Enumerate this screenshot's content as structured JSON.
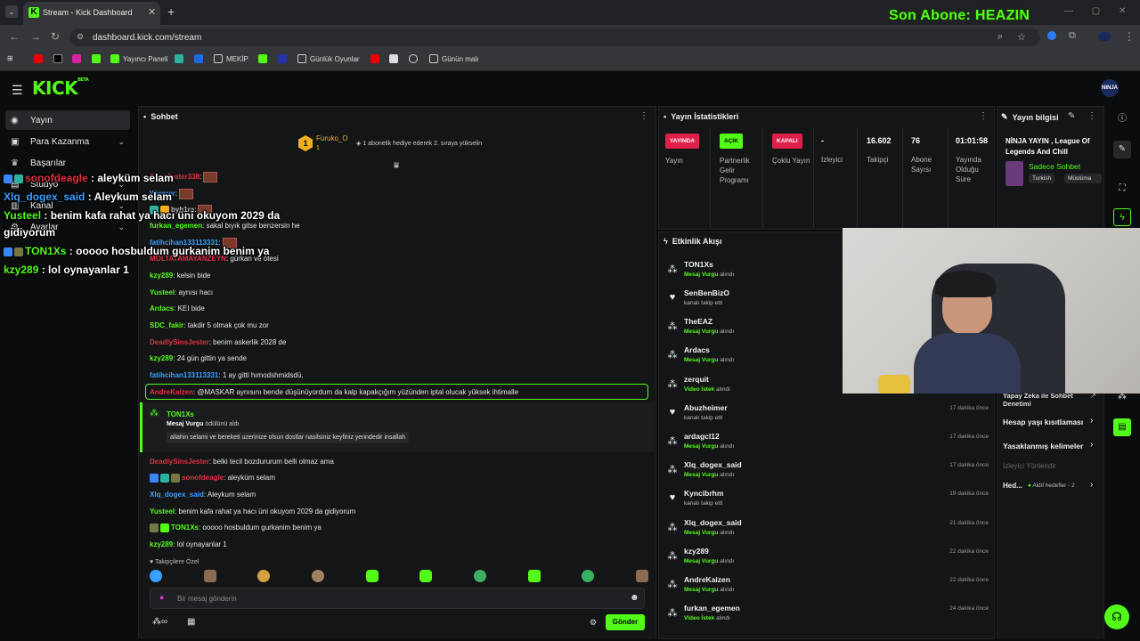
{
  "browser": {
    "tab_title": "Stream - Kick Dashboard",
    "url": "dashboard.kick.com/stream",
    "bookmarks": [
      "Yayıncı Paneli",
      "MEKİP",
      "Günlük Oyunlar",
      "Günün malı"
    ]
  },
  "overlay": {
    "last_sub": "Son Abone: HEAZIN",
    "chat": [
      {
        "user": "sonofdeagle",
        "text": " : aleyküm selam",
        "color": "#e03040"
      },
      {
        "user": "Xlq_dogex_said",
        "text": " : Aleykum selam",
        "color": "#3aa0ff"
      },
      {
        "user": "Yusteel",
        "text": " : benim kafa rahat ya hacı üni okuyom 2029 da",
        "color": "#53fc18"
      },
      {
        "user": "",
        "text": "gidiyorum",
        "color": "#fff"
      },
      {
        "user": "TON1Xs",
        "text": " : ooooo hosbuldum gurkanim benim ya",
        "color": "#53fc18"
      },
      {
        "user": "kzy289",
        "text": " : lol oynayanlar 1",
        "color": "#53fc18"
      }
    ]
  },
  "sidebar": {
    "items": [
      {
        "label": "Yayın",
        "icon": "stream-icon"
      },
      {
        "label": "Para Kazanma",
        "icon": "money-icon"
      },
      {
        "label": "Başarılar",
        "icon": "trophy-icon"
      },
      {
        "label": "Stüdyo",
        "icon": "studio-icon"
      },
      {
        "label": "Kanal",
        "icon": "channel-icon"
      },
      {
        "label": "Ayarlar",
        "icon": "settings-icon"
      }
    ]
  },
  "chat": {
    "title": "Sohbet",
    "pinned_user": "Furuko_O",
    "pinned_rank": "1",
    "pinned_count": "1",
    "pinned_text": "1 abonelik hediye ederek 2. sıraya yükselin",
    "messages": [
      {
        "user": "SlinsJester338",
        "text": ":",
        "color": "#e03040"
      },
      {
        "user": "Wwerer",
        "text": ":",
        "color": "#3aa0ff"
      },
      {
        "user": "byh1ra",
        "text": ":",
        "color": "#bbb"
      },
      {
        "user": "furkan_egemen",
        "text": ": sakal bıyık gitse benzersin he",
        "color": "#53fc18"
      },
      {
        "user": "fatihcihan133113331",
        "text": ":",
        "color": "#3aa0ff"
      },
      {
        "user": "MOLTATAMAYANZEYN",
        "text": ": gürkan ve ötesi",
        "color": "#e03040"
      },
      {
        "user": "kzy289",
        "text": ": kelsin bide",
        "color": "#53fc18"
      },
      {
        "user": "Yusteel",
        "text": ": aynısı hacı",
        "color": "#53fc18"
      },
      {
        "user": "Ardacs",
        "text": ": KEI bide",
        "color": "#53fc18"
      },
      {
        "user": "SDC_fakir",
        "text": ": takdir 5 olmak çok mu zor",
        "color": "#53fc18"
      },
      {
        "user": "DeadlySinsJester",
        "text": ": benim askerlik 2028 de",
        "color": "#e03040"
      },
      {
        "user": "kzy289",
        "text": ": 24 gün gittin ya sende",
        "color": "#53fc18"
      },
      {
        "user": "fatihcihan133113331",
        "text": ": 1 ay gitti hımodshmidsdü,",
        "color": "#3aa0ff"
      },
      {
        "user": "AndreKaizen",
        "text": ": @MASKAR aynısını bende düşünüyordum da kalp kapakçığım yüzünden iptal olucak yüksek ihtimalle",
        "color": "#e03040"
      },
      {
        "user": "DeadlySinsJester",
        "text": ": belki tecil bozdururum belli olmaz ama",
        "color": "#e03040"
      },
      {
        "user": "sonofdeagle",
        "text": ": aleyküm selam",
        "color": "#e03040"
      },
      {
        "user": "Xlq_dogex_said",
        "text": ": Aleykum selam",
        "color": "#3aa0ff"
      },
      {
        "user": "Yusteel",
        "text": ": benim kafa rahat ya hacı üni okuyom 2029 da gidiyorum",
        "color": "#53fc18"
      },
      {
        "user": "TON1Xs",
        "text": ": ooooo hosbuldum gurkanim benim ya",
        "color": "#53fc18"
      },
      {
        "user": "kzy289",
        "text": ": lol oynayanlar 1",
        "color": "#53fc18"
      }
    ],
    "highlight": {
      "user": "TON1Xs",
      "action": "Mesaj Vurgu",
      "action_suffix": " ödülünü aldı",
      "text": "allahin selami ve bereketi uzerinize olsun dostlar nasilsiniz keyfiniz yerindedir insallah"
    },
    "emote_tab": "Takipçilere Özel",
    "input_placeholder": "Bir mesaj gönderin",
    "send_label": "Gönder"
  },
  "stats": {
    "title": "Yayın İstatistikleri",
    "cols": [
      {
        "pill": "YAYINDA",
        "pill_color": "#e0204a",
        "label": "Yayın"
      },
      {
        "pill": "AÇIK",
        "pill_color": "#53fc18",
        "label": "Partnerlik Gelir Programı"
      },
      {
        "pill": "KAPALI",
        "pill_color": "#e0204a",
        "label": "Çoklu Yayın"
      },
      {
        "value": "-",
        "label": "İzleyici"
      },
      {
        "value": "16.602",
        "label": "Takipçi"
      },
      {
        "value": "76",
        "label": "Abone Sayısı"
      },
      {
        "value": "01:01:58",
        "label": "Yayında Olduğu Süre"
      }
    ]
  },
  "activity": {
    "title": "Etkinlik Akışı",
    "items": [
      {
        "name": "TON1Xs",
        "desc_hl": "Mesaj Vurgu",
        "desc": " alındı",
        "time": "",
        "icon": "highlight-icon"
      },
      {
        "name": "SenBenBizO",
        "desc_hl": "",
        "desc": "kanalı takip etti",
        "time": "",
        "icon": "heart-icon"
      },
      {
        "name": "TheEAZ",
        "desc_hl": "Mesaj Vurgu",
        "desc": " alındı",
        "time": "",
        "icon": "highlight-icon"
      },
      {
        "name": "Ardacs",
        "desc_hl": "Mesaj Vurgu",
        "desc": " alındı",
        "time": "",
        "icon": "highlight-icon"
      },
      {
        "name": "zerquit",
        "desc_hl": "Video İstek",
        "desc": " alındı",
        "time": "",
        "icon": "highlight-icon"
      },
      {
        "name": "Abuzheimer",
        "desc_hl": "",
        "desc": "kanalı takip etti",
        "time": "17 dakika önce",
        "icon": "heart-icon"
      },
      {
        "name": "ardagcl12",
        "desc_hl": "Mesaj Vurgu",
        "desc": " alındı",
        "time": "17 dakika önce",
        "icon": "highlight-icon"
      },
      {
        "name": "Xlq_dogex_said",
        "desc_hl": "Mesaj Vurgu",
        "desc": " alındı",
        "time": "17 dakika önce",
        "icon": "highlight-icon"
      },
      {
        "name": "Kyncibrhm",
        "desc_hl": "",
        "desc": "kanalı takip etti",
        "time": "19 dakika önce",
        "icon": "heart-icon"
      },
      {
        "name": "Xlq_dogex_said",
        "desc_hl": "Mesaj Vurgu",
        "desc": " alındı",
        "time": "21 dakika önce",
        "icon": "highlight-icon"
      },
      {
        "name": "kzy289",
        "desc_hl": "Mesaj Vurgu",
        "desc": " alındı",
        "time": "22 dakika önce",
        "icon": "highlight-icon"
      },
      {
        "name": "AndreKaizen",
        "desc_hl": "Mesaj Vurgu",
        "desc": " alındı",
        "time": "22 dakika önce",
        "icon": "highlight-icon"
      },
      {
        "name": "furkan_egemen",
        "desc_hl": "Video İstek",
        "desc": " alındı",
        "time": "24 dakika önce",
        "icon": "highlight-icon"
      }
    ]
  },
  "info": {
    "title": "Yayın bilgisi",
    "stream_title": "NİNJA YAYIN , League Of Legends And Chill",
    "category": "Sadece Sohbet",
    "tags": [
      "Turkish",
      "Müslüma"
    ],
    "links": [
      {
        "label": "Yapay Zeka ile Sohbet Denetimi"
      },
      {
        "label": "Hesap yaşı kısıtlaması"
      },
      {
        "label": "Yasaklanmış kelimeler"
      }
    ],
    "viewer_directions": "İzleyici Yönlendir",
    "hed_label": "Hed...",
    "hed_status": "Aktif hedefler - 2"
  },
  "colors": {
    "accent": "#53fc18",
    "live": "#e0204a",
    "bg": "#0b0c0d",
    "panel": "#141517"
  }
}
